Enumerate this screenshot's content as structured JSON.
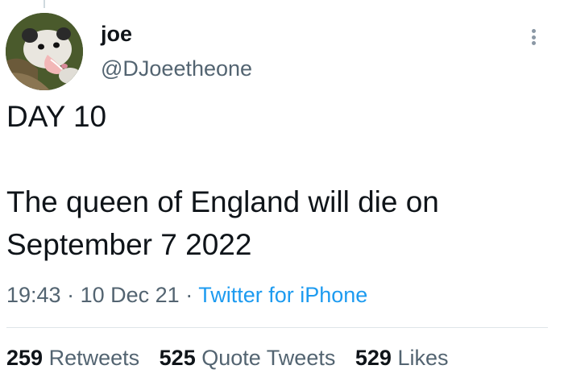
{
  "author": {
    "name": "joe",
    "handle": "@DJoeetheone",
    "avatar_icon": "opossum-avatar"
  },
  "more_icon": "more-dots-icon",
  "tweet": {
    "lines": [
      "DAY 10",
      "",
      "The queen of England will die on",
      "September 7 2022"
    ]
  },
  "meta": {
    "time": "19:43",
    "separator": "·",
    "date": "10 Dec 21",
    "source": "Twitter for iPhone"
  },
  "stats": [
    {
      "count": "259",
      "label": "Retweets"
    },
    {
      "count": "525",
      "label": "Quote Tweets"
    },
    {
      "count": "529",
      "label": "Likes"
    }
  ],
  "colors": {
    "text": "#0f1419",
    "secondary": "#536471",
    "link": "#1d9bf0",
    "divider": "#dfe5e9"
  }
}
